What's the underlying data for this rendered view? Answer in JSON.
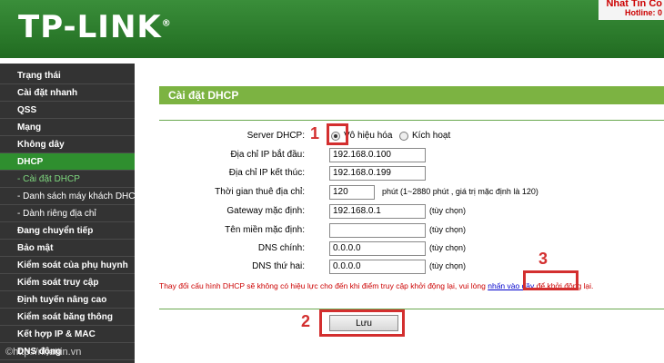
{
  "header": {
    "logo": "TP-LINK",
    "logo_reg": "®",
    "watermark_top": "Nhat Tin Co",
    "hotline": "Hotline: 0"
  },
  "sidebar": {
    "items": [
      {
        "label": "Trạng thái"
      },
      {
        "label": "Cài đặt nhanh"
      },
      {
        "label": "QSS"
      },
      {
        "label": "Mạng"
      },
      {
        "label": "Không dây"
      },
      {
        "label": "DHCP"
      },
      {
        "label": "- Cài đặt DHCP"
      },
      {
        "label": "- Danh sách máy khách DHCP"
      },
      {
        "label": "- Dành riêng địa chỉ"
      },
      {
        "label": "Đang chuyển tiếp"
      },
      {
        "label": "Bảo mật"
      },
      {
        "label": "Kiểm soát của phụ huynh"
      },
      {
        "label": "Kiểm soát truy cập"
      },
      {
        "label": "Định tuyến nâng cao"
      },
      {
        "label": "Kiểm soát băng thông"
      },
      {
        "label": "Kết hợp IP & MAC"
      },
      {
        "label": "DNS động"
      }
    ]
  },
  "page": {
    "title": "Cài đặt DHCP"
  },
  "form": {
    "server_label": "Server DHCP:",
    "server_disable": "Vô hiệu hóa",
    "server_enable": "Kích hoạt",
    "start_ip_label": "Địa chỉ IP bắt đầu:",
    "start_ip_value": "192.168.0.100",
    "end_ip_label": "Địa chỉ IP kết thúc:",
    "end_ip_value": "192.168.0.199",
    "lease_label": "Thời gian thuê địa chỉ:",
    "lease_value": "120",
    "lease_hint": "phút (1~2880 phút , giá trị mặc định là 120)",
    "gateway_label": "Gateway mặc định:",
    "gateway_value": "192.168.0.1",
    "gateway_hint": "(tùy chọn)",
    "domain_label": "Tên miền mặc định:",
    "domain_value": "",
    "domain_hint": "(tùy chọn)",
    "dns1_label": "DNS chính:",
    "dns1_value": "0.0.0.0",
    "dns1_hint": "(tùy chọn)",
    "dns2_label": "DNS thứ hai:",
    "dns2_value": "0.0.0.0",
    "dns2_hint": "(tùy chọn)"
  },
  "warning": {
    "text_before": "Thay đổi cấu hình DHCP sẽ không có hiệu lực cho đến khi điểm truy cập khởi động lại, vui lòng ",
    "link": "nhấn vào đây",
    "text_after": " để khởi động lại."
  },
  "actions": {
    "save_label": "Lưu"
  },
  "annotations": {
    "marker1": "1",
    "marker2": "2",
    "marker3": "3"
  },
  "watermark_bottom": "©http://nhattin.vn",
  "colors": {
    "header_green": "#2b7a2b",
    "sidebar_bg": "#333333",
    "active_green": "#2f8f2f",
    "title_green": "#7cb342",
    "annotation_red": "#d32f2f"
  }
}
